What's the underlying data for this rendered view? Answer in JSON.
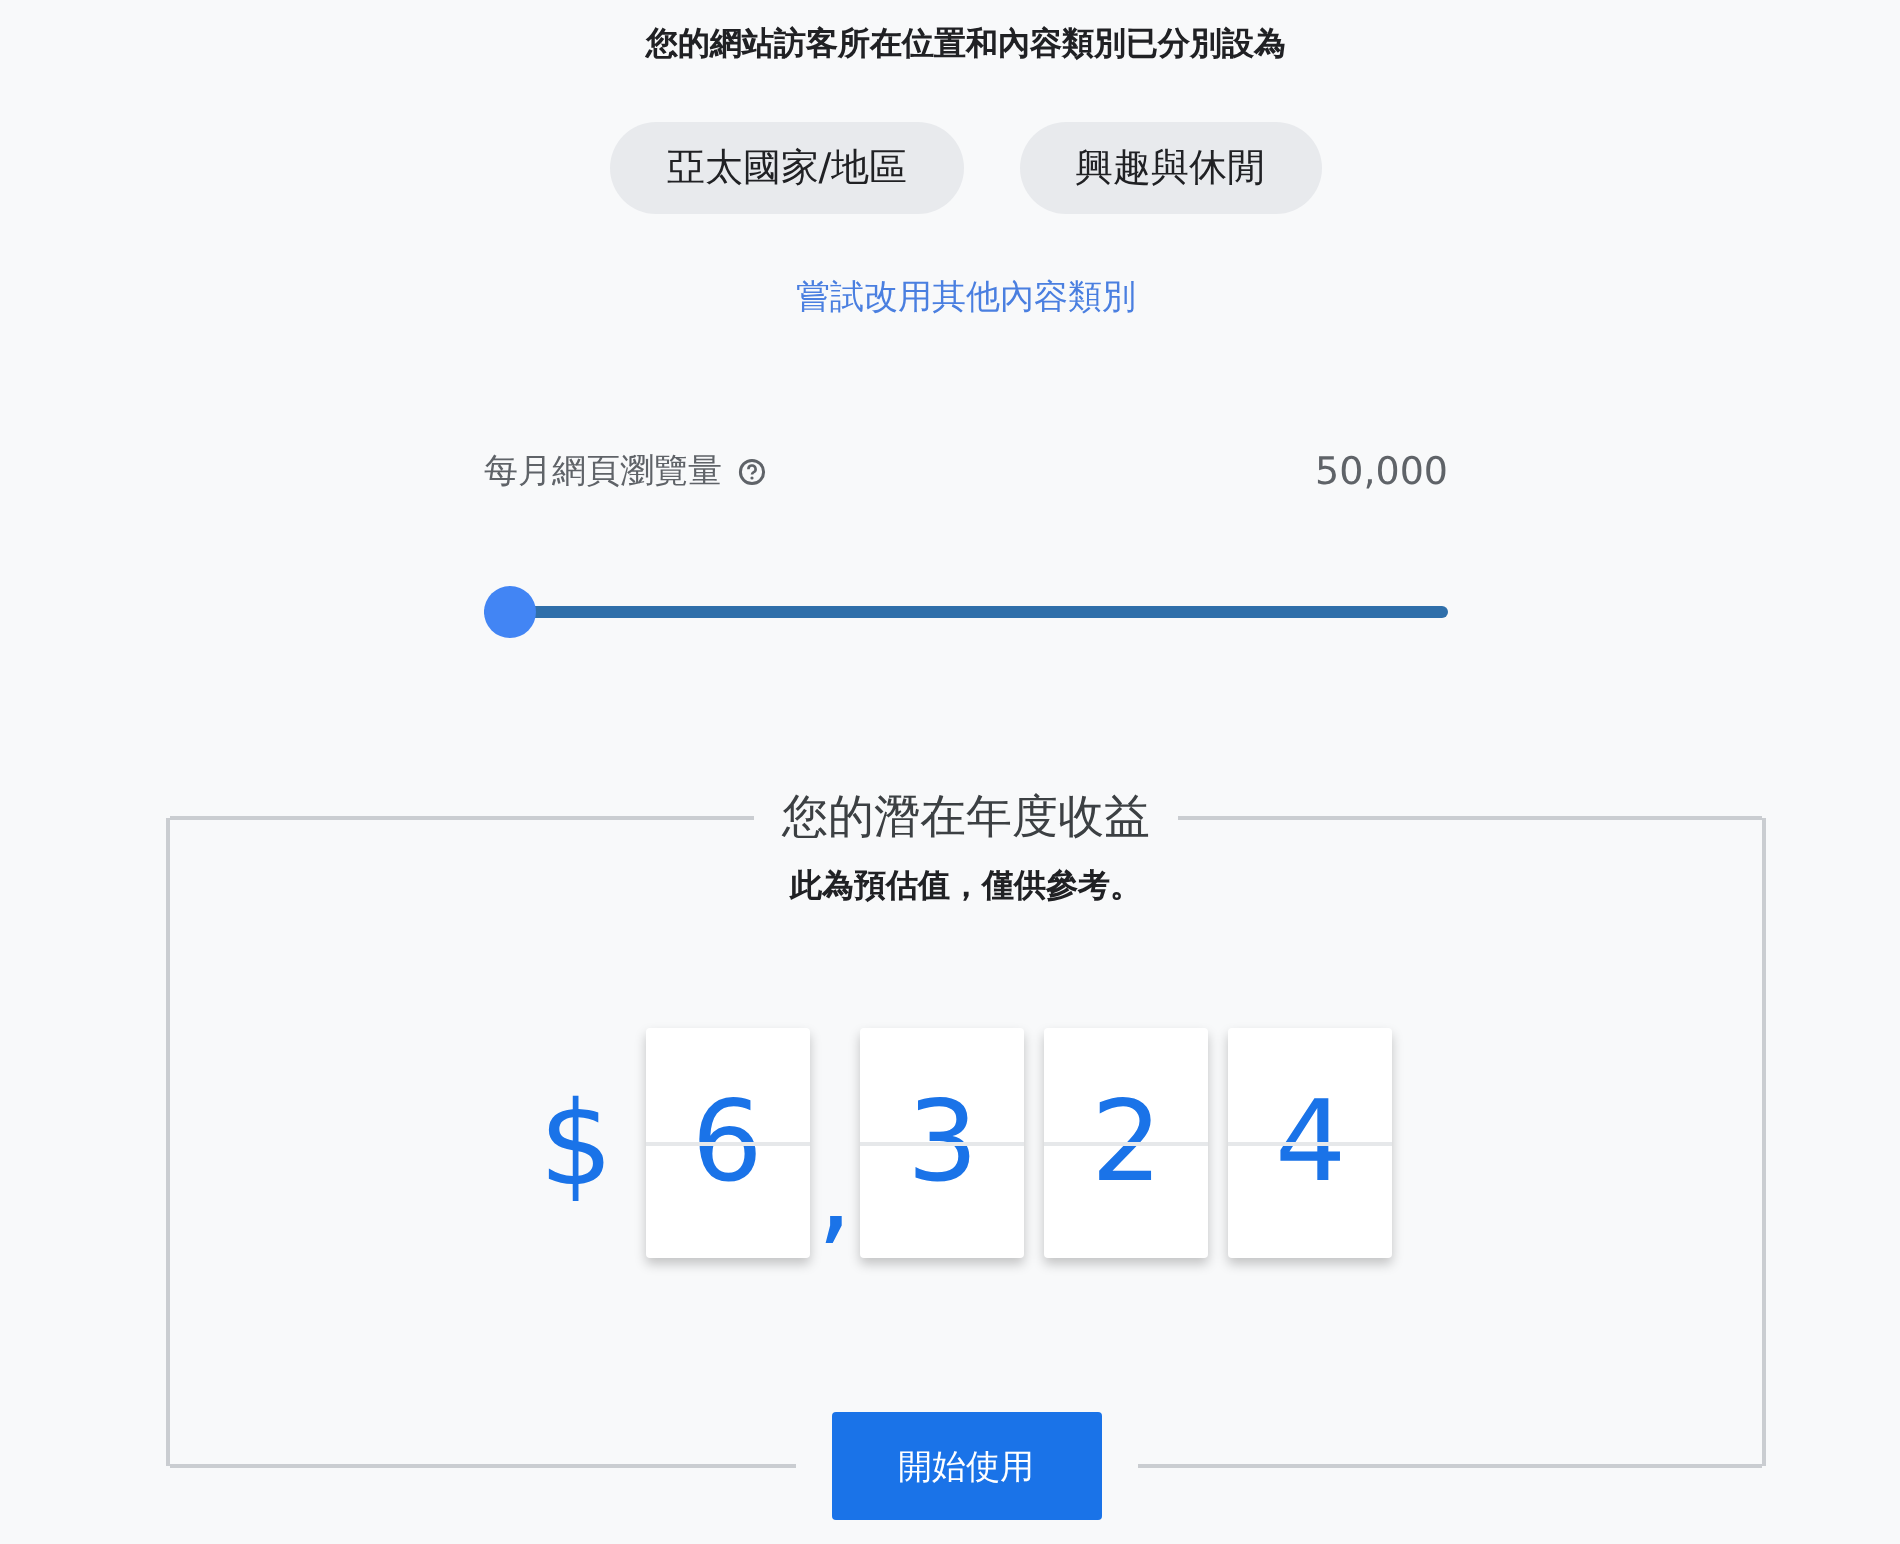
{
  "intro": "您的網站訪客所在位置和內容類別已分別設為",
  "chips": [
    {
      "label": "亞太國家/地區"
    },
    {
      "label": "興趣與休閒"
    }
  ],
  "link": "嘗試改用其他內容類別",
  "slider": {
    "label": "每月網頁瀏覽量",
    "value": "50,000",
    "level": 0
  },
  "estimate": {
    "title": "您的潛在年度收益",
    "note": "此為預估值，僅供參考。",
    "currency": "$",
    "figures": [
      {
        "kind": "digit",
        "text": "6"
      },
      {
        "kind": "separator",
        "text": ","
      },
      {
        "kind": "digit",
        "text": "3"
      },
      {
        "kind": "digit",
        "text": "2"
      },
      {
        "kind": "digit",
        "text": "4"
      }
    ],
    "button": "開始使用"
  }
}
